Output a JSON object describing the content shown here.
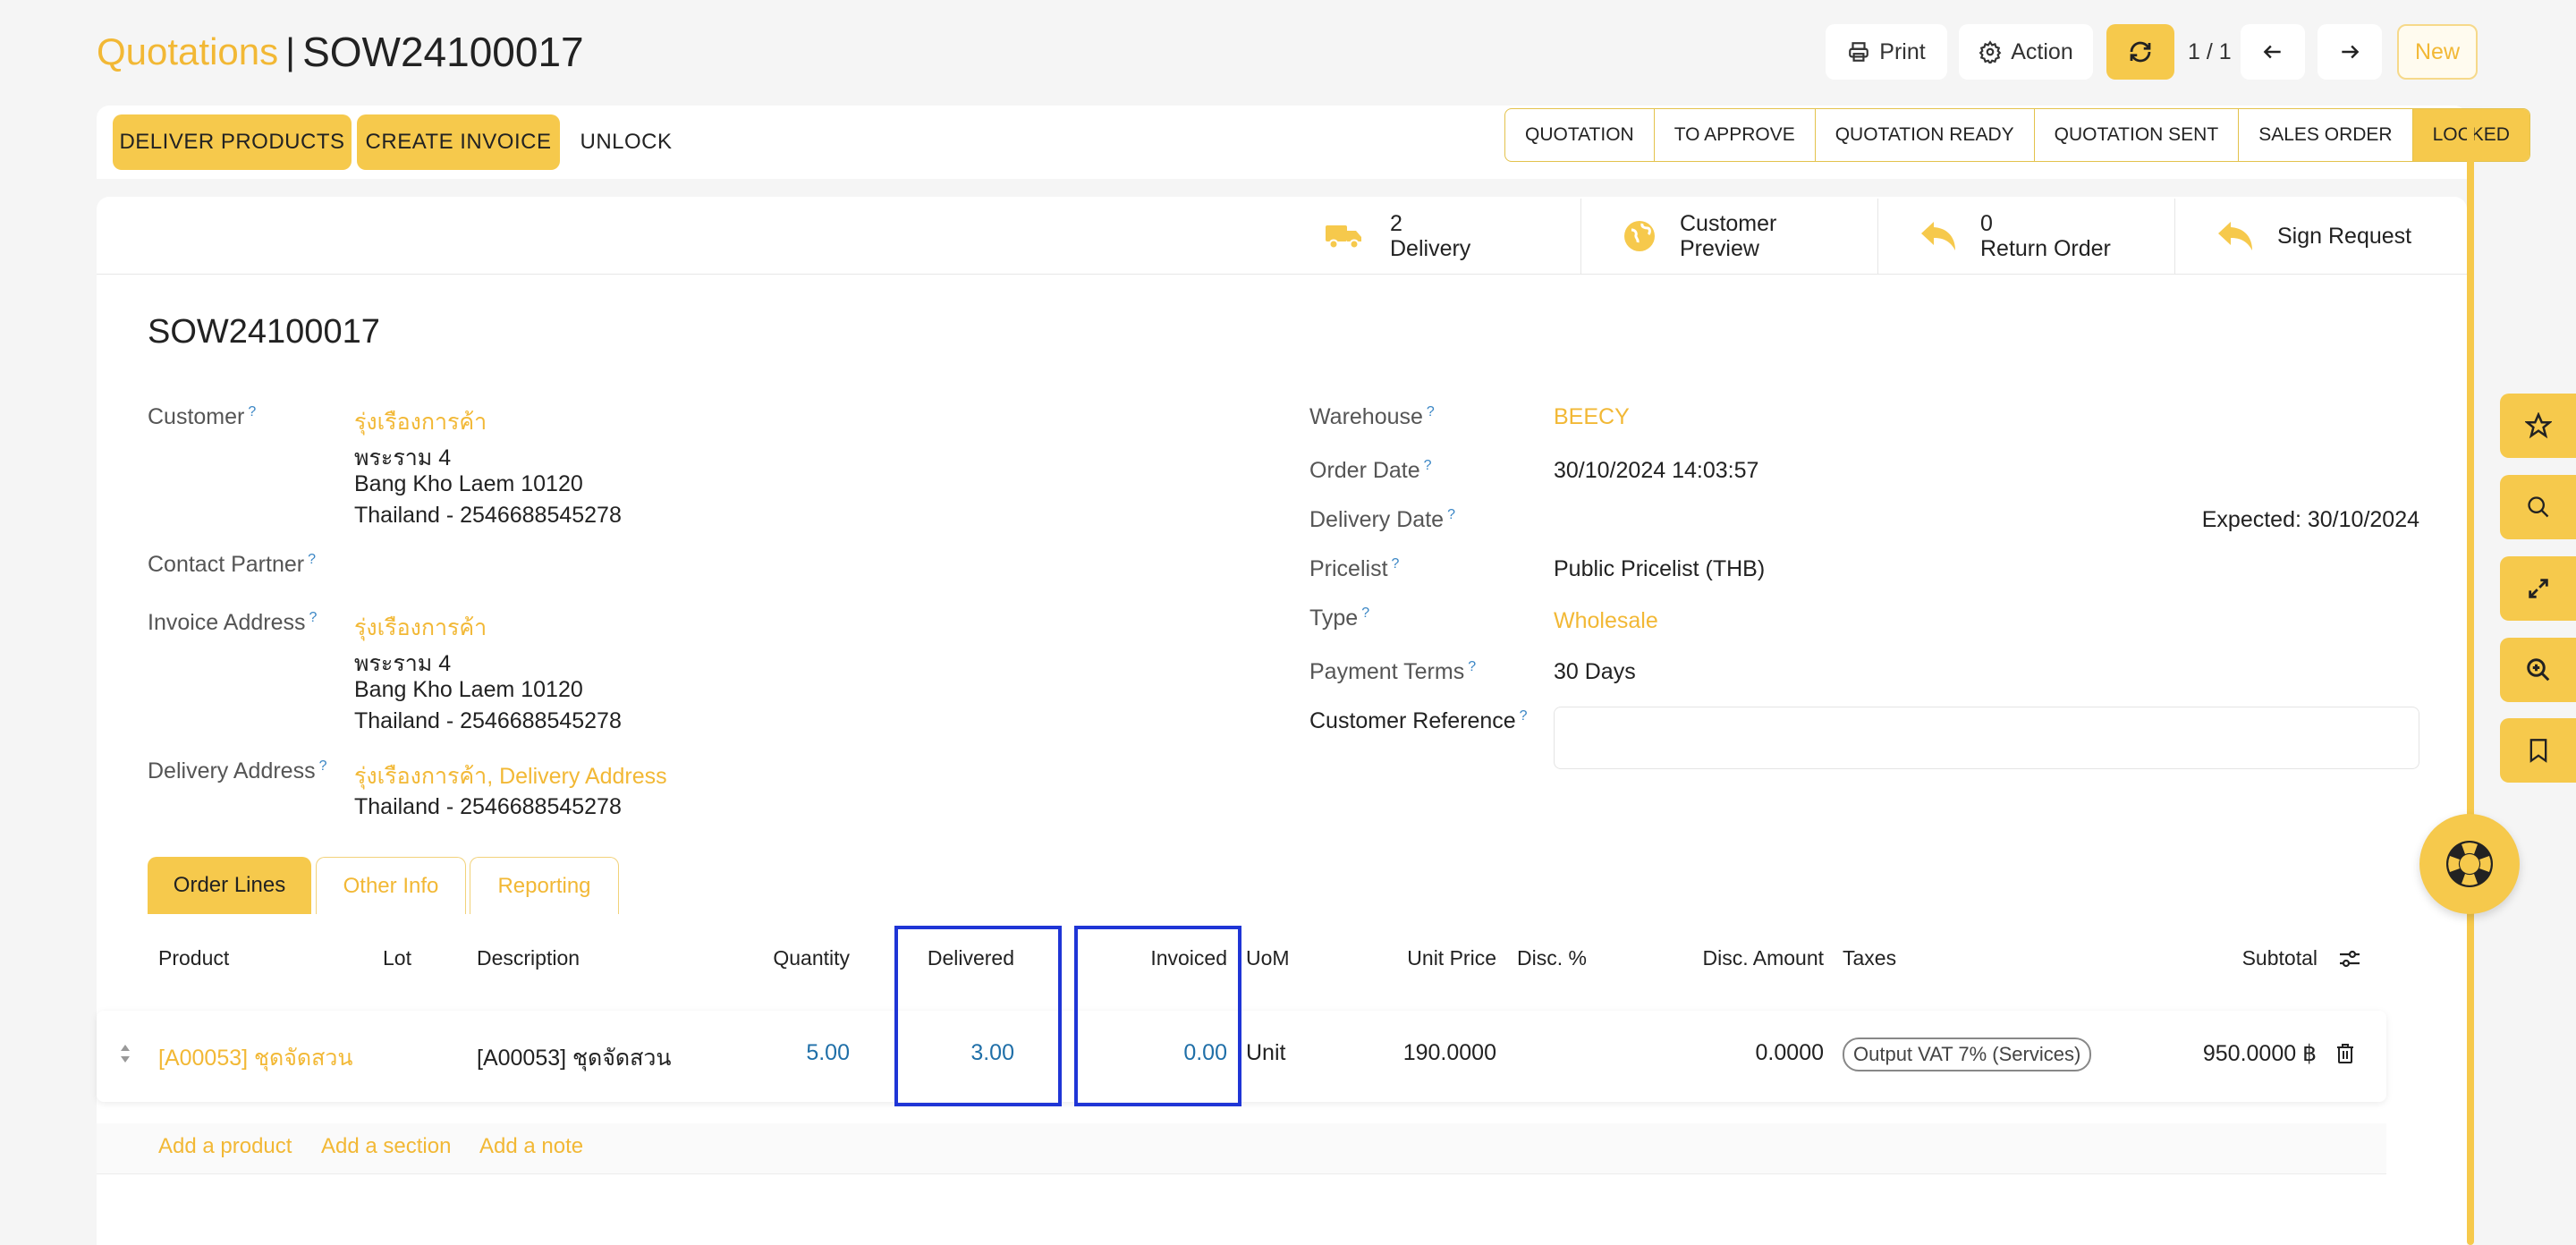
{
  "header": {
    "breadcrumb": "Quotations",
    "separator": "|",
    "record": "SOW24100017",
    "print": "Print",
    "action": "Action",
    "pager": "1 / 1",
    "new": "New"
  },
  "statusbar": {
    "buttons": [
      "DELIVER PRODUCTS",
      "CREATE INVOICE",
      "UNLOCK"
    ],
    "stages": [
      "QUOTATION",
      "TO APPROVE",
      "QUOTATION READY",
      "QUOTATION SENT",
      "SALES ORDER",
      "LOCKED"
    ],
    "active_stage": "LOCKED"
  },
  "smart_buttons": {
    "delivery_count": "2",
    "delivery_label": "Delivery",
    "preview_line1": "Customer",
    "preview_line2": "Preview",
    "return_count": "0",
    "return_label": "Return Order",
    "sign_label": "Sign Request"
  },
  "form": {
    "title": "SOW24100017",
    "q": "?",
    "customer": {
      "label": "Customer",
      "name": "รุ่งเรืองการค้า",
      "line1": "พระราม 4",
      "line2": "Bang Kho Laem 10120",
      "line3": "Thailand - 2546688545278"
    },
    "contact_partner_label": "Contact Partner",
    "invoice": {
      "label": "Invoice Address",
      "name": "รุ่งเรืองการค้า",
      "line1": "พระราม 4",
      "line2": "Bang Kho Laem 10120",
      "line3": "Thailand - 2546688545278"
    },
    "delivery": {
      "label": "Delivery Address",
      "name": "รุ่งเรืองการค้า, Delivery Address",
      "line1": "Thailand - 2546688545278"
    },
    "warehouse_label": "Warehouse",
    "warehouse": "BEECY",
    "order_date_label": "Order Date",
    "order_date": "30/10/2024 14:03:57",
    "delivery_date_label": "Delivery Date",
    "expected": "Expected: 30/10/2024",
    "pricelist_label": "Pricelist",
    "pricelist": "Public Pricelist (THB)",
    "type_label": "Type",
    "type": "Wholesale",
    "payment_terms_label": "Payment Terms",
    "payment_terms": "30 Days",
    "customer_ref_label": "Customer Reference",
    "customer_ref": ""
  },
  "tabs": [
    "Order Lines",
    "Other Info",
    "Reporting"
  ],
  "table": {
    "headers": {
      "product": "Product",
      "lot": "Lot",
      "description": "Description",
      "quantity": "Quantity",
      "delivered": "Delivered",
      "invoiced": "Invoiced",
      "uom": "UoM",
      "unit_price": "Unit Price",
      "disc_pct": "Disc. %",
      "disc_amount": "Disc. Amount",
      "taxes": "Taxes",
      "subtotal": "Subtotal"
    },
    "row": {
      "product": "[A00053] ชุดจัดสวน",
      "lot": "",
      "description": "[A00053] ชุดจัดสวน",
      "quantity": "5.00",
      "delivered": "3.00",
      "invoiced": "0.00",
      "uom": "Unit",
      "unit_price": "190.0000",
      "disc_pct": "",
      "disc_amount": "0.0000",
      "taxes": "Output VAT 7% (Services)",
      "subtotal": "950.0000 ฿"
    },
    "add_product": "Add a product",
    "add_section": "Add a section",
    "add_note": "Add a note"
  },
  "colors": {
    "accent": "#f6c94c",
    "link": "#f2b835",
    "number_blue": "#1f6fa8",
    "highlight_box": "#1f35d6"
  }
}
